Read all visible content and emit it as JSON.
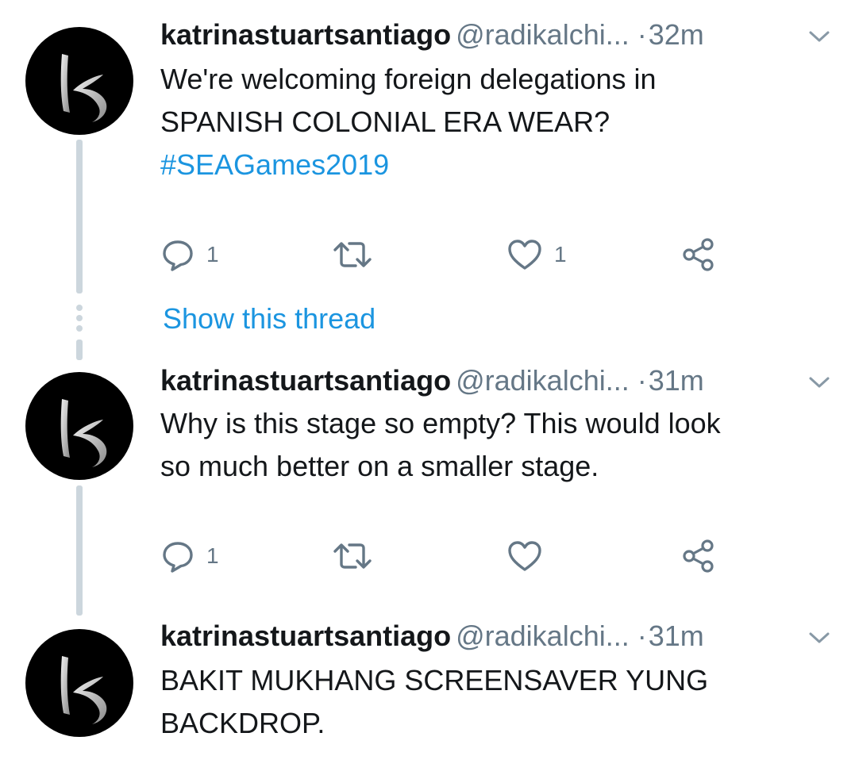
{
  "tweets": [
    {
      "name": "katrinastuartsantiago",
      "handle": "@radikalchi...",
      "separator": "·",
      "time": "32m",
      "text_lines": [
        "We're welcoming foreign delegations in",
        "SPANISH COLONIAL ERA WEAR?"
      ],
      "hashtag": "#SEAGames2019",
      "reply_count": "1",
      "retweet_count": "",
      "like_count": "1"
    },
    {
      "name": "katrinastuartsantiago",
      "handle": "@radikalchi...",
      "separator": "·",
      "time": "31m",
      "text_lines": [
        "Why is this stage so empty? This would look",
        "so much better on a smaller stage."
      ],
      "hashtag": "",
      "reply_count": "1",
      "retweet_count": "",
      "like_count": ""
    },
    {
      "name": "katrinastuartsantiago",
      "handle": "@radikalchi...",
      "separator": "·",
      "time": "31m",
      "text_lines": [
        "BAKIT MUKHANG SCREENSAVER YUNG",
        "BACKDROP."
      ],
      "hashtag": "",
      "reply_count": "",
      "retweet_count": "",
      "like_count": ""
    }
  ],
  "show_thread_label": "Show this thread",
  "icons": {
    "reply": "reply-icon",
    "retweet": "retweet-icon",
    "like": "heart-icon",
    "share": "share-icon",
    "caret": "chevron-down-icon"
  },
  "colors": {
    "text": "#14171a",
    "secondary": "#657786",
    "link": "#1b95e0",
    "thread_line": "#ccd6dd",
    "avatar_bg": "#000000"
  }
}
